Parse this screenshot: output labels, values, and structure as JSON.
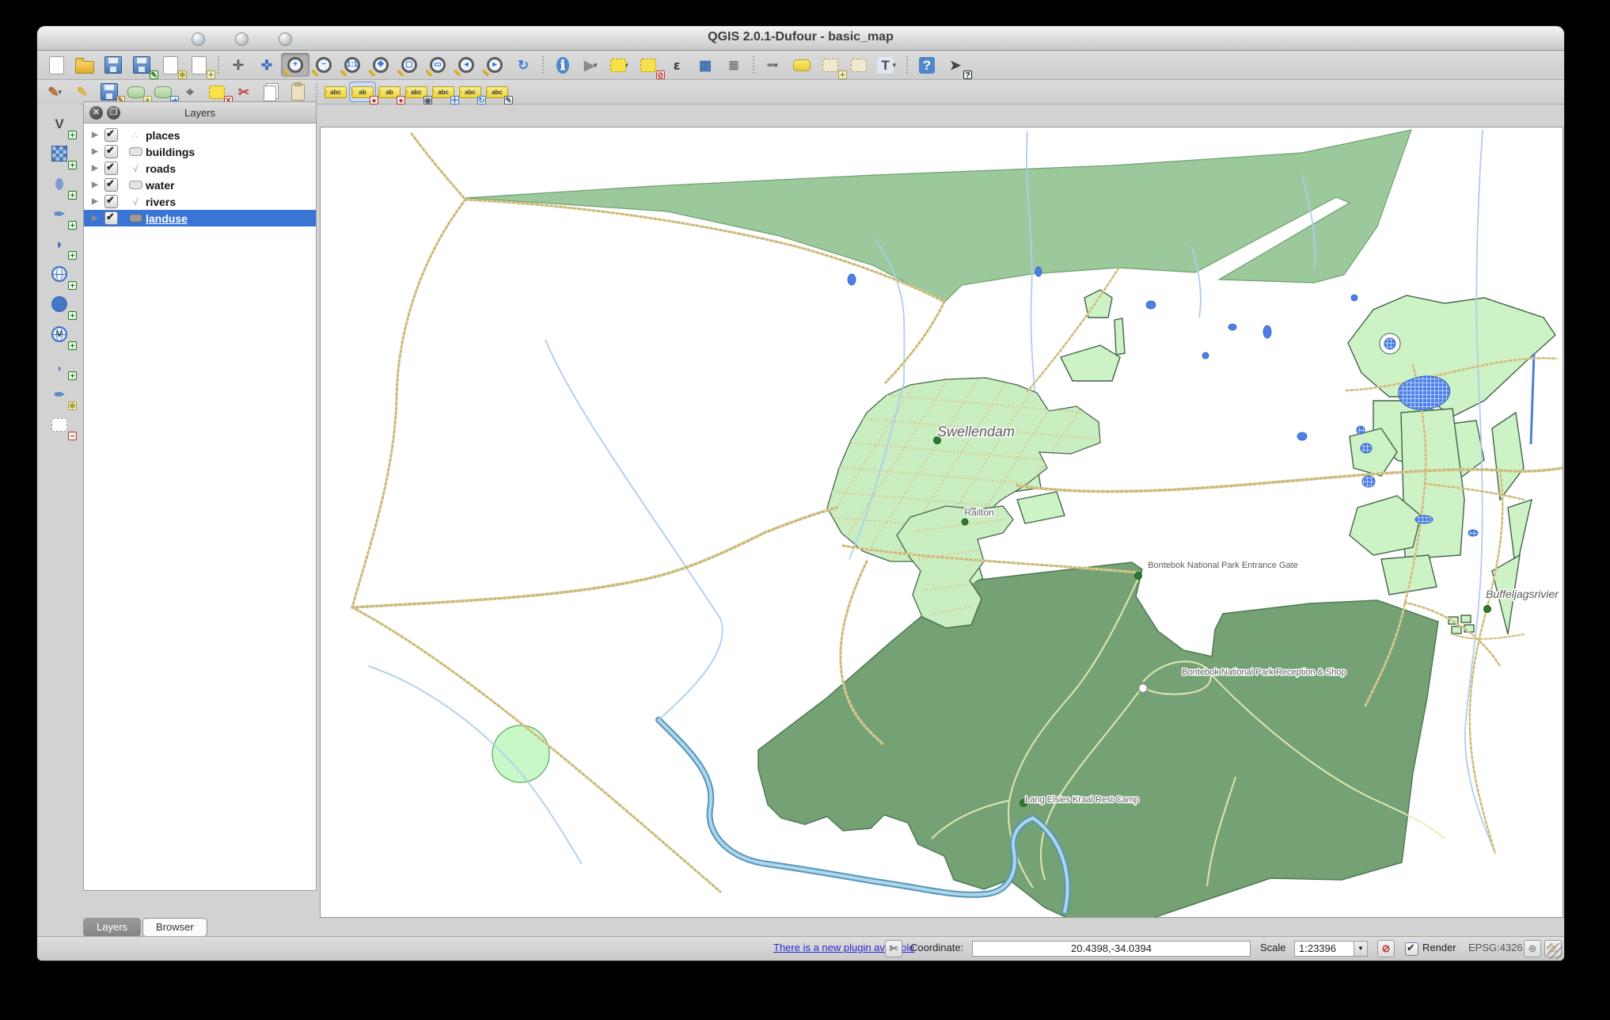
{
  "window": {
    "title": "QGIS 2.0.1-Dufour - basic_map",
    "traffic_lights": [
      "close",
      "minimize",
      "zoom"
    ]
  },
  "toolbars": {
    "main": [
      {
        "name": "new-project",
        "type": "file"
      },
      {
        "name": "open-project",
        "type": "folder"
      },
      {
        "name": "save-project",
        "type": "floppy"
      },
      {
        "name": "save-project-as",
        "type": "floppy",
        "badge": "✎",
        "badgec": "#1e7a1e"
      },
      {
        "name": "new-print-composer",
        "type": "file",
        "badge": "✱",
        "badgec": "#b09a20"
      },
      {
        "name": "composer-manager",
        "type": "file",
        "badge": "✦",
        "badgec": "#b09a20"
      },
      {
        "sep": true
      },
      {
        "name": "pan-map",
        "type": "glyph",
        "g": "✛",
        "c": "#5a5a5a"
      },
      {
        "name": "pan-to-selection",
        "type": "glyph",
        "g": "✜",
        "c": "#3f6fc0"
      },
      {
        "name": "zoom-in",
        "type": "mag",
        "sub": "+",
        "active": true
      },
      {
        "name": "zoom-out",
        "type": "mag",
        "sub": "−"
      },
      {
        "name": "zoom-native",
        "type": "mag",
        "sub": "1:1"
      },
      {
        "name": "zoom-full",
        "type": "mag",
        "sub": "✥"
      },
      {
        "name": "zoom-to-selection",
        "type": "mag",
        "sub": "▢"
      },
      {
        "name": "zoom-to-layer",
        "type": "mag",
        "sub": "▭"
      },
      {
        "name": "zoom-last",
        "type": "mag",
        "sub": "◂"
      },
      {
        "name": "zoom-next",
        "type": "mag",
        "sub": "▸"
      },
      {
        "name": "map-refresh",
        "type": "glyph",
        "g": "↻",
        "c": "#3f7fd6"
      },
      {
        "sep": true
      },
      {
        "name": "identify-features",
        "type": "glyph",
        "g": "ℹ",
        "c": "#ffffff",
        "bg": "#4f87c7",
        "round": true
      },
      {
        "name": "run-feature-action",
        "type": "glyph",
        "g": "▶",
        "c": "#8a8a8a",
        "round": true,
        "dd": true
      },
      {
        "name": "select-features",
        "type": "square",
        "c": "#f7e04a",
        "border": "#b09a20",
        "dd": true
      },
      {
        "name": "deselect-features",
        "type": "square",
        "c": "#f7e04a",
        "border": "#b09a20",
        "badge": "⊘",
        "badgec": "#c23030"
      },
      {
        "name": "select-by-expression",
        "type": "glyph",
        "g": "ε",
        "c": "#2b2b2b"
      },
      {
        "name": "open-attribute-table",
        "type": "glyph",
        "g": "▦",
        "c": "#3a6fae"
      },
      {
        "name": "field-calculator",
        "type": "glyph",
        "g": "≣",
        "c": "#777777"
      },
      {
        "sep": true
      },
      {
        "name": "measure-line",
        "type": "glyph",
        "g": "┅",
        "c": "#777777",
        "dd": true
      },
      {
        "name": "map-tips",
        "type": "bubble"
      },
      {
        "name": "new-bookmark",
        "type": "square",
        "c": "#efe8cf",
        "border": "#a89a60",
        "badge": "✦",
        "badgec": "#b09a20"
      },
      {
        "name": "show-bookmarks",
        "type": "square",
        "c": "#efe8cf",
        "border": "#a89a60"
      },
      {
        "name": "text-annotation",
        "type": "glyph",
        "g": "T",
        "c": "#445",
        "bg": "#dfe7f2",
        "dd": true
      },
      {
        "sep": true
      },
      {
        "name": "help-contents",
        "type": "glyph",
        "g": "?",
        "c": "#ffffff",
        "bg": "#4f87c7"
      },
      {
        "name": "whats-this",
        "type": "glyph",
        "g": "➤",
        "c": "#444444",
        "badge": "?",
        "badgec": "#222222"
      }
    ],
    "edit": [
      {
        "name": "current-edits",
        "type": "glyph",
        "g": "✎",
        "c": "#b06a2a",
        "dd": true
      },
      {
        "name": "toggle-editing",
        "type": "glyph",
        "g": "✎",
        "c": "#d8b13c"
      },
      {
        "name": "save-layer-edits",
        "type": "floppy",
        "badge": "✎",
        "badgec": "#b06a2a"
      },
      {
        "name": "add-feature",
        "type": "blob",
        "badge": "✦",
        "badgec": "#b09a20"
      },
      {
        "name": "move-feature",
        "type": "blob",
        "badge": "➜",
        "badgec": "#3f6fc0"
      },
      {
        "name": "node-tool",
        "type": "glyph",
        "g": "⌖",
        "c": "#6a6a6a"
      },
      {
        "name": "delete-selected",
        "type": "square",
        "c": "#f7e04a",
        "border": "#b09a20",
        "badge": "✕",
        "badgec": "#c23030"
      },
      {
        "name": "cut-features",
        "type": "glyph",
        "g": "✂",
        "c": "#c04545"
      },
      {
        "name": "copy-features",
        "type": "pages"
      },
      {
        "name": "paste-features",
        "type": "clip"
      },
      {
        "sep": true
      },
      {
        "name": "layer-labeling-options",
        "type": "abc",
        "t": "abc"
      },
      {
        "name": "pin-unpin-labels",
        "type": "abc",
        "t": "ab",
        "badge": "●",
        "badgec": "#c23030",
        "active": true
      },
      {
        "name": "highlight-pinned-labels",
        "type": "abc",
        "t": "ab",
        "badge": "●",
        "badgec": "#c23030"
      },
      {
        "name": "show-hide-labels",
        "type": "abc",
        "t": "abc",
        "badge": "◉",
        "badgec": "#556"
      },
      {
        "name": "move-label",
        "type": "abc",
        "t": "abc",
        "badge": "✛",
        "badgec": "#3f6fc0"
      },
      {
        "name": "rotate-label",
        "type": "abc",
        "t": "abc",
        "badge": "↻",
        "badgec": "#3f6fc0"
      },
      {
        "name": "change-label-properties",
        "type": "abc",
        "t": "abc",
        "badge": "✎",
        "badgec": "#556"
      }
    ],
    "left": [
      {
        "name": "add-vector-layer",
        "type": "glyph",
        "g": "V",
        "c": "#4a4a4a",
        "badge": "+",
        "badgec": "#1e7a1e"
      },
      {
        "name": "add-raster-layer",
        "type": "raster",
        "badge": "+",
        "badgec": "#1e7a1e"
      },
      {
        "name": "add-postgis-layer",
        "type": "glyph",
        "g": "⬮",
        "c": "#7a9ad0",
        "badge": "+",
        "badgec": "#1e7a1e"
      },
      {
        "name": "add-spatialite-layer",
        "type": "glyph",
        "g": "✒",
        "c": "#5b84c4",
        "badge": "+",
        "badgec": "#1e7a1e"
      },
      {
        "name": "add-mssql-layer",
        "type": "glyph",
        "g": "◗",
        "c": "#3f6fc0",
        "badge": "+",
        "badgec": "#1e7a1e"
      },
      {
        "name": "add-wms-layer",
        "type": "globe",
        "badge": "+",
        "badgec": "#1e7a1e"
      },
      {
        "name": "add-wcs-layer",
        "type": "globe",
        "solid": true,
        "badge": "+",
        "badgec": "#1e7a1e"
      },
      {
        "name": "add-wfs-layer",
        "type": "globe",
        "ovl": "V",
        "badge": "+",
        "badgec": "#1e7a1e"
      },
      {
        "name": "add-delimited-text-layer",
        "type": "glyph",
        "g": ",",
        "c": "#3f6fc0",
        "badge": "+",
        "badgec": "#1e7a1e"
      },
      {
        "name": "new-spatialite-layer",
        "type": "glyph",
        "g": "✒",
        "c": "#5b84c4",
        "badge": "✱",
        "badgec": "#b09a20"
      },
      {
        "name": "remove-layer",
        "type": "square",
        "c": "#ffffff",
        "border": "#999999",
        "badge": "−",
        "badgec": "#c23030"
      }
    ]
  },
  "layers_panel": {
    "title": "Layers",
    "header_buttons": [
      "close",
      "float"
    ],
    "items": [
      {
        "label": "places",
        "type": "point",
        "checked": true,
        "selected": false
      },
      {
        "label": "buildings",
        "type": "polygon",
        "checked": true,
        "selected": false
      },
      {
        "label": "roads",
        "type": "line",
        "checked": true,
        "selected": false
      },
      {
        "label": "water",
        "type": "polygon",
        "checked": true,
        "selected": false
      },
      {
        "label": "rivers",
        "type": "line",
        "checked": true,
        "selected": false
      },
      {
        "label": "landuse",
        "type": "polygon",
        "checked": true,
        "selected": true
      }
    ],
    "tabs": [
      {
        "label": "Layers",
        "active": true
      },
      {
        "label": "Browser",
        "active": false
      }
    ]
  },
  "map": {
    "labels": [
      {
        "text": "Swellendam",
        "kind": "town"
      },
      {
        "text": "Railton",
        "kind": "town-small"
      },
      {
        "text": "Bontebok National Park Entrance Gate",
        "kind": "poi"
      },
      {
        "text": "Bontebok National Park Reception & Shop",
        "kind": "poi"
      },
      {
        "text": "Lang Elsies Kraal Rest Camp",
        "kind": "poi"
      },
      {
        "text": "Buffeljagsrivier",
        "kind": "town"
      }
    ],
    "colors": {
      "forest": "#9bc99b",
      "park": "#74a274",
      "urban": "#c9eec2",
      "farm": "#cdf2c5",
      "road": "#e5d7a1",
      "river": "#aecdf0",
      "water": "#4d80e6",
      "selection": "#3875d7",
      "circle": "#c8f8c8"
    }
  },
  "statusbar": {
    "plugin_link": "There is a new plugin available",
    "coordinate_label": "Coordinate:",
    "coordinate_value": "20.4398,-34.0394",
    "scale_label": "Scale",
    "scale_value": "1:23396",
    "render_label": "Render",
    "render_checked": true,
    "crs": "EPSG:4326"
  }
}
